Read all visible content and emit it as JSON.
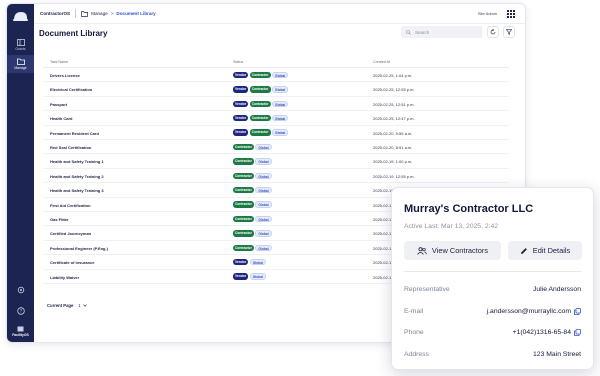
{
  "app": {
    "brand": "ContractorOS"
  },
  "breadcrumb": {
    "section": "Manage",
    "separator": ">",
    "current": "Document Library"
  },
  "user": {
    "name": "Site Admin"
  },
  "sidebar": {
    "items": [
      {
        "label": "Grants",
        "icon": "grants-icon"
      },
      {
        "label": "Manage",
        "icon": "manage-icon"
      }
    ],
    "bottom": [
      {
        "label": "",
        "icon": "settings-icon"
      },
      {
        "label": "",
        "icon": "help-icon"
      },
      {
        "label": "FacilityOS",
        "icon": "building-icon"
      }
    ]
  },
  "page": {
    "title": "Document Library"
  },
  "search": {
    "placeholder": "Search"
  },
  "table": {
    "columns": [
      "Task Name",
      "Status",
      "Created At"
    ],
    "rows": [
      {
        "name": "Drivers License",
        "badges": [
          "Vendor",
          "Contractor",
          "Global"
        ],
        "created": "2025-02-25, 1:04 p.m."
      },
      {
        "name": "Electrical Certification",
        "badges": [
          "Vendor",
          "Contractor",
          "Global"
        ],
        "created": "2025-02-25, 12:55 p.m."
      },
      {
        "name": "Passport",
        "badges": [
          "Vendor",
          "Contractor",
          "Global"
        ],
        "created": "2025-02-25, 12:51 p.m."
      },
      {
        "name": "Health Card",
        "badges": [
          "Vendor",
          "Contractor",
          "Global"
        ],
        "created": "2025-02-25, 12:47 p.m."
      },
      {
        "name": "Permanent Resident Card",
        "badges": [
          "Vendor",
          "Contractor",
          "Global"
        ],
        "created": "2025-02-20, 9:55 a.m."
      },
      {
        "name": "Red Seal Certification",
        "badges": [
          "Contractor",
          "Global"
        ],
        "created": "2025-02-20, 8:51 a.m."
      },
      {
        "name": "Health and Safety Training 1",
        "badges": [
          "Contractor",
          "Global"
        ],
        "created": "2025-02-19, 1:00 p.m."
      },
      {
        "name": "Health and Safety Training 2",
        "badges": [
          "Contractor",
          "Global"
        ],
        "created": "2025-02-19, 12:55 p.m."
      },
      {
        "name": "Health and Safety Training 3",
        "badges": [
          "Contractor",
          "Global"
        ],
        "created": "2025-02-19, 12:53 p.m."
      },
      {
        "name": "First Aid Certification",
        "badges": [
          "Contractor",
          "Global"
        ],
        "created": "2025-02-19, 12:50 p.m."
      },
      {
        "name": "Gas Fitter",
        "badges": [
          "Contractor",
          "Global"
        ],
        "created": "2025-02-19, 12:47 p.m."
      },
      {
        "name": "Certified Journeyman",
        "badges": [
          "Contractor",
          "Global"
        ],
        "created": "2025-02-19, 12:45 p.m."
      },
      {
        "name": "Professional Engineer (P.Eng.)",
        "badges": [
          "Contractor",
          "Global"
        ],
        "created": "2025-02-19, 12:40 p.m."
      },
      {
        "name": "Certificate of Insurance",
        "badges": [
          "Vendor",
          "Global"
        ],
        "created": "2025-02-19, 12:35 p.m."
      },
      {
        "name": "Liability Waiver",
        "badges": [
          "Vendor",
          "Global"
        ],
        "created": "2025-02-19, 12:30 p.m."
      }
    ]
  },
  "pager": {
    "label": "Current Page",
    "value": "1"
  },
  "card": {
    "name": "Murray's Contractor LLC",
    "active": "Active Last: Mar 13, 2025, 2:42",
    "view_label": "View Contractors",
    "edit_label": "Edit Details",
    "fields": [
      {
        "key": "Representative",
        "value": "Julie Andersson",
        "copy": false
      },
      {
        "key": "E-mail",
        "value": "j.andersson@murrayllc.com",
        "copy": true
      },
      {
        "key": "Phone",
        "value": "+1(042)1316-65-84",
        "copy": true
      },
      {
        "key": "Address",
        "value": "123 Main Street",
        "copy": false
      }
    ]
  },
  "colors": {
    "sidebar": "#1c2451",
    "vendor": "#1d2680",
    "contractor": "#1e7a45",
    "global": "#e6ecfb",
    "accent": "#3450c8"
  }
}
